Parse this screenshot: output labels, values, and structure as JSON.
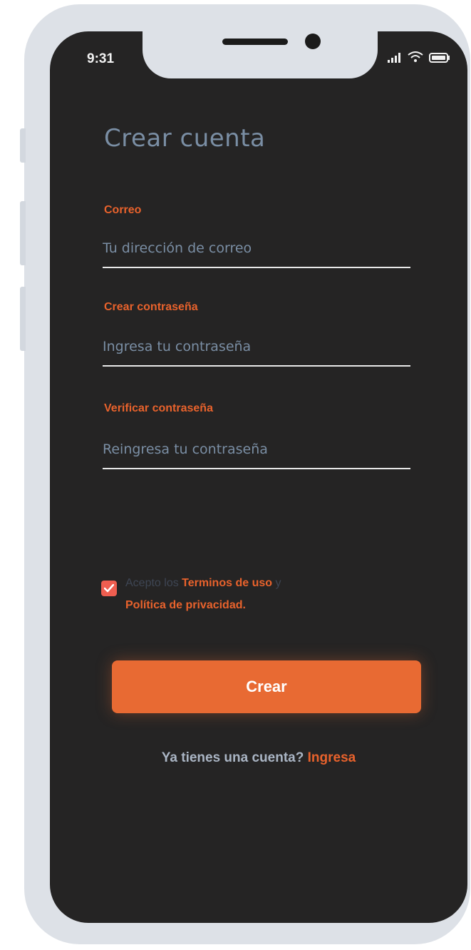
{
  "status_bar": {
    "time": "9:31",
    "icons": [
      "signal-icon",
      "wifi-icon",
      "battery-icon"
    ]
  },
  "screen": {
    "title": "Crear cuenta"
  },
  "form": {
    "email": {
      "label": "Correo",
      "placeholder": "Tu dirección de correo",
      "value": ""
    },
    "password": {
      "label": "Crear contraseña",
      "placeholder": "Ingresa tu contraseña",
      "value": ""
    },
    "verify_password": {
      "label": "Verificar contraseña",
      "placeholder": "Reingresa tu contraseña",
      "value": ""
    }
  },
  "terms": {
    "checked": true,
    "prefix": "Acepto los",
    "terms_link": "Terminos de uso",
    "conjunction": "y",
    "privacy_link": "Política de privacidad."
  },
  "actions": {
    "create_label": "Crear"
  },
  "footer": {
    "question": "Ya tienes una cuenta?",
    "signin_link": "Ingresa"
  },
  "colors": {
    "accent": "#e86a33",
    "label": "#e8622c",
    "background": "#252424",
    "title": "#7a8ea4",
    "checkbox": "#ef5e50"
  }
}
